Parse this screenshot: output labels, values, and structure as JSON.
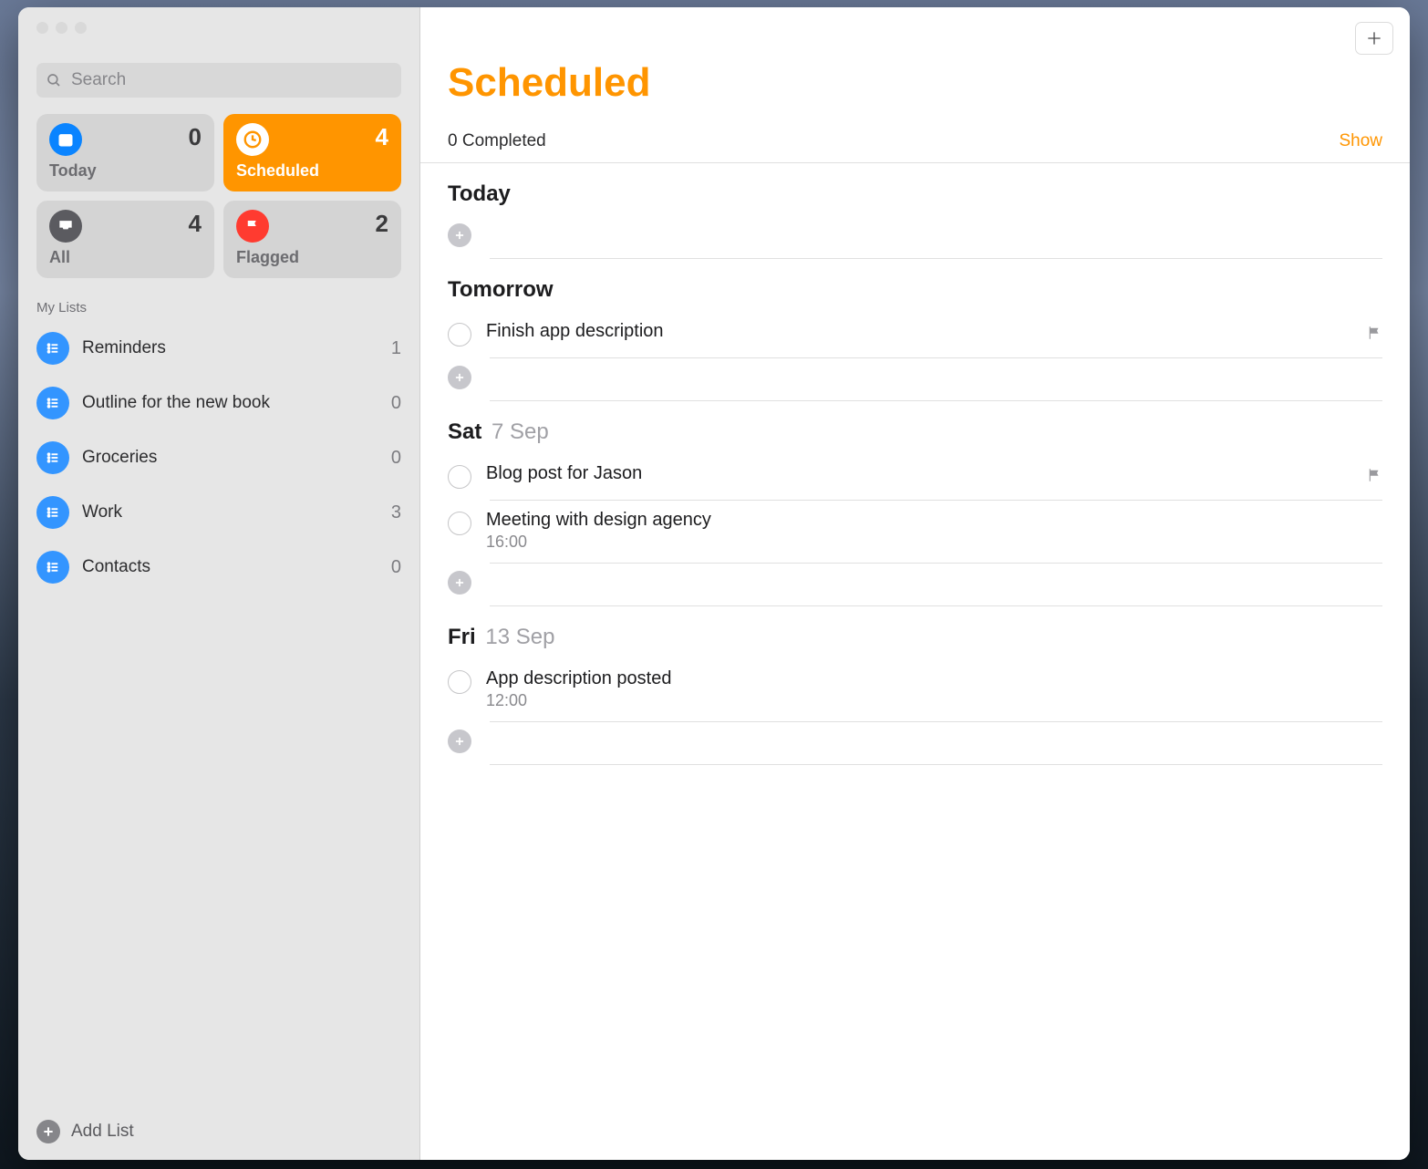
{
  "search": {
    "placeholder": "Search"
  },
  "smart": {
    "today": {
      "label": "Today",
      "count": "0"
    },
    "scheduled": {
      "label": "Scheduled",
      "count": "4"
    },
    "all": {
      "label": "All",
      "count": "4"
    },
    "flagged": {
      "label": "Flagged",
      "count": "2"
    }
  },
  "lists_header": "My Lists",
  "lists": [
    {
      "name": "Reminders",
      "count": "1"
    },
    {
      "name": "Outline for the new book",
      "count": "0"
    },
    {
      "name": "Groceries",
      "count": "0"
    },
    {
      "name": "Work",
      "count": "3"
    },
    {
      "name": "Contacts",
      "count": "0"
    }
  ],
  "add_list_label": "Add List",
  "main": {
    "title": "Scheduled",
    "completed_text": "0 Completed",
    "show_label": "Show",
    "sections": [
      {
        "heading_strong": "Today",
        "heading_weak": "",
        "items": []
      },
      {
        "heading_strong": "Tomorrow",
        "heading_weak": "",
        "items": [
          {
            "title": "Finish app description",
            "time": "",
            "flagged": true
          }
        ]
      },
      {
        "heading_strong": "Sat",
        "heading_weak": "7 Sep",
        "items": [
          {
            "title": "Blog post for Jason",
            "time": "",
            "flagged": true
          },
          {
            "title": "Meeting with design agency",
            "time": "16:00",
            "flagged": false
          }
        ]
      },
      {
        "heading_strong": "Fri",
        "heading_weak": "13 Sep",
        "items": [
          {
            "title": "App description posted",
            "time": "12:00",
            "flagged": false
          }
        ]
      }
    ]
  }
}
